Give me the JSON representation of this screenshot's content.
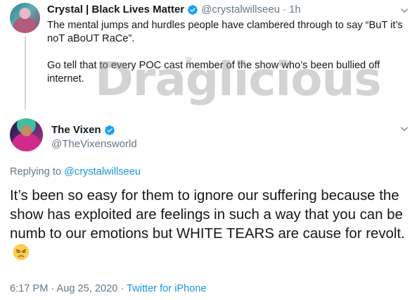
{
  "tweet1": {
    "display_name": "Crystal | Black Lives Matter",
    "handle": "@crystalwillseeu",
    "separator": "·",
    "time": "1h",
    "paragraphs": [
      "The mental jumps and hurdles people have clambered through to say “BuT it’s noT aBoUT RaCe”.",
      "Go tell that to every POC cast member of the show who’s been bullied off internet."
    ]
  },
  "watermark": {
    "text": "Draglicious",
    "crown": "♛"
  },
  "tweet2": {
    "display_name": "The Vixen",
    "handle": "@TheVixensworld",
    "replying_prefix": "Replying to",
    "replying_to": "@crystalwillseeu",
    "text": "It’s been so easy for them to ignore our suffering because the show has exploited are feelings in such a way that you can be numb to our emotions but WHITE TEARS are cause for revolt.",
    "emoji": "weary-face-icon",
    "timestamp": "6:17 PM · Aug 25, 2020",
    "separator": "·",
    "source": "Twitter for iPhone"
  },
  "colors": {
    "text": "#14171a",
    "muted": "#657786",
    "link": "#1b95e0",
    "verified": "#1da1f2",
    "thread_line": "#ccd6dd"
  }
}
